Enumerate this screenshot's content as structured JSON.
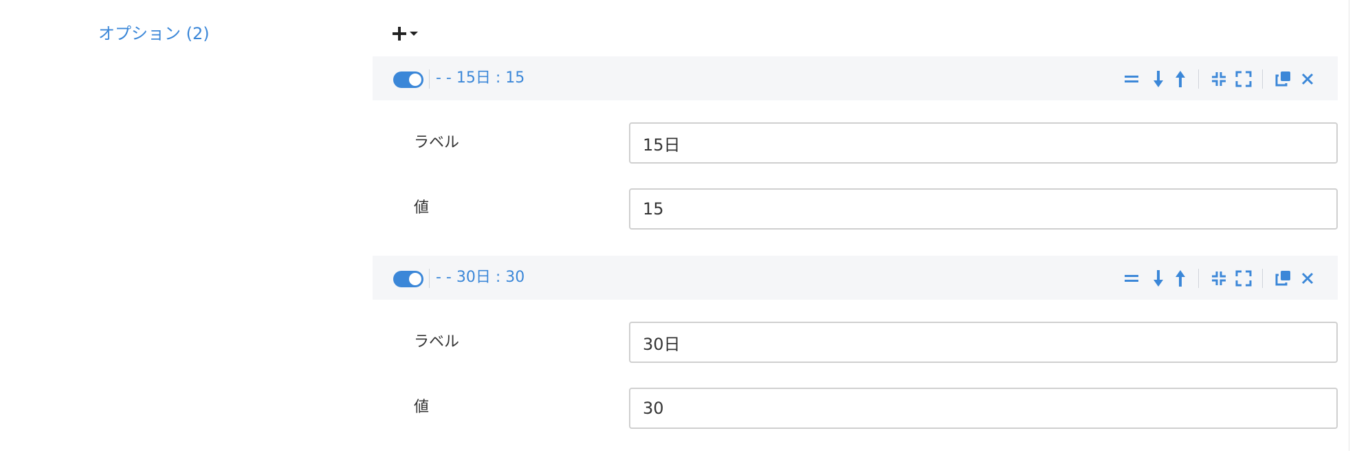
{
  "section": {
    "title": "オプション (2)"
  },
  "toolbar": {
    "add_icon": "plus-icon",
    "menu_icon": "caret-down-icon"
  },
  "colors": {
    "accent": "#3b87d8",
    "header_bg": "#f5f6f8",
    "text": "#333333",
    "input_border": "#cfcfcf"
  },
  "options": [
    {
      "enabled": true,
      "header": "- - 15日 : 15",
      "label_caption": "ラベル",
      "label_value": "15日",
      "value_caption": "値",
      "value_value": "15"
    },
    {
      "enabled": true,
      "header": "- - 30日 : 30",
      "label_caption": "ラベル",
      "label_value": "30日",
      "value_caption": "値",
      "value_value": "30"
    }
  ],
  "header_actions": [
    "drag-handle-icon",
    "move-down-icon",
    "move-up-icon",
    "collapse-icon",
    "expand-icon",
    "duplicate-icon",
    "close-icon"
  ]
}
